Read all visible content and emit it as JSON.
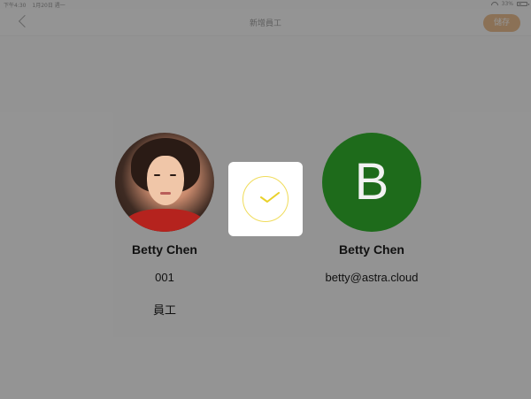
{
  "status_bar": {
    "time": "下午4:30",
    "date": "1月20日 週一",
    "battery": "33%",
    "battery_level": 0.33
  },
  "nav": {
    "title": "新增員工",
    "save_label": "儲存"
  },
  "employee": {
    "name": "Betty Chen",
    "number": "001",
    "role": "員工"
  },
  "account": {
    "initial": "B",
    "name": "Betty Chen",
    "email": "betty@astra.cloud"
  },
  "colors": {
    "accent": "#d87a1c",
    "avatar_green": "#1e6b1b",
    "check_yellow": "#e9d12a"
  },
  "icons": {
    "back": "chevron-left-icon",
    "success": "check-icon",
    "wifi": "wifi-icon",
    "battery": "battery-icon"
  }
}
